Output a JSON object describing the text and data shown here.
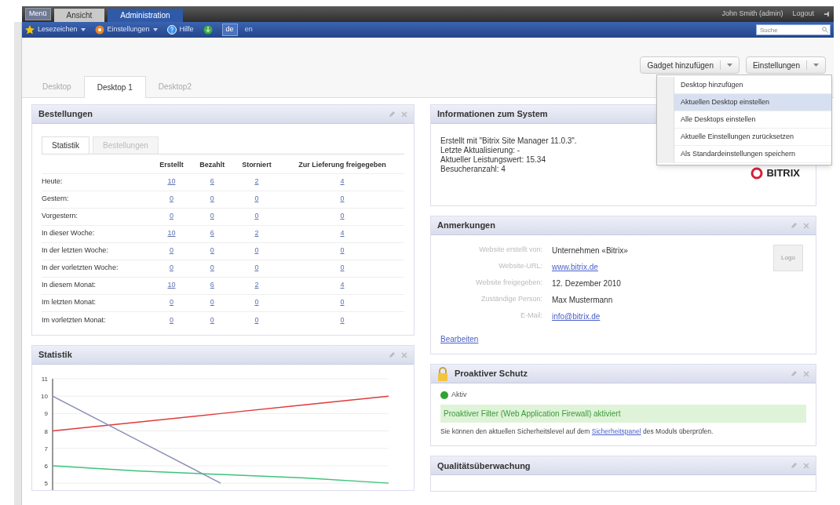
{
  "top_bar": {
    "menu_button": "Menü",
    "tabs": [
      {
        "label": "Ansicht",
        "selected": false
      },
      {
        "label": "Administration",
        "selected": true
      }
    ],
    "user": "John Smith (admin)",
    "logout": "Logout"
  },
  "toolbar": {
    "items": [
      {
        "label": "Lesezeichen",
        "kind": "star",
        "dropdown": true
      },
      {
        "label": "Einstellungen",
        "kind": "gear",
        "dropdown": true
      },
      {
        "label": "Hilfe",
        "kind": "help",
        "dropdown": false
      }
    ],
    "languages": [
      {
        "label": "de",
        "selected": true
      },
      {
        "label": "en",
        "selected": false
      }
    ],
    "search": {
      "placeholder": "Suche"
    }
  },
  "desktop_tabs": [
    {
      "label": "Desktop",
      "selected": false
    },
    {
      "label": "Desktop 1",
      "selected": true
    },
    {
      "label": "Desktop2",
      "selected": false
    }
  ],
  "actions": [
    "Gadget hinzufügen",
    "Einstellungen"
  ],
  "settings_menu": [
    {
      "label": "Desktop hinzufügen",
      "selected": false
    },
    {
      "label": "Aktuellen Desktop einstellen",
      "selected": true
    },
    {
      "label": "Alle Desktops einstellen",
      "selected": false
    },
    {
      "label": "Aktuelle Einstellungen zurücksetzen",
      "selected": false
    },
    {
      "label": "Als Standardeinstellungen speichern",
      "selected": false
    }
  ],
  "orders": {
    "title": "Bestellungen",
    "tabs": [
      {
        "label": "Statistik",
        "selected": true
      },
      {
        "label": "Bestellungen",
        "selected": false
      }
    ],
    "columns": [
      "Erstellt",
      "Bezahlt",
      "Storniert",
      "Zur Lieferung freigegeben"
    ],
    "rows": [
      {
        "label": "Heute:",
        "values": [
          "10",
          "6",
          "2",
          "4"
        ]
      },
      {
        "label": "Gestern:",
        "values": [
          "0",
          "0",
          "0",
          "0"
        ]
      },
      {
        "label": "Vorgestern:",
        "values": [
          "0",
          "0",
          "0",
          "0"
        ]
      },
      {
        "label": "In dieser Woche:",
        "values": [
          "10",
          "6",
          "2",
          "4"
        ]
      },
      {
        "label": "In der letzten Woche:",
        "values": [
          "0",
          "0",
          "0",
          "0"
        ]
      },
      {
        "label": "In der vorletzten Woche:",
        "values": [
          "0",
          "0",
          "0",
          "0"
        ]
      },
      {
        "label": "In diesem Monat:",
        "values": [
          "10",
          "6",
          "2",
          "4"
        ]
      },
      {
        "label": "Im letzten Monat:",
        "values": [
          "0",
          "0",
          "0",
          "0"
        ]
      },
      {
        "label": "Im vorletzten Monat:",
        "values": [
          "0",
          "0",
          "0",
          "0"
        ]
      }
    ]
  },
  "statistics": {
    "title": "Statistik",
    "chart_data": {
      "type": "line",
      "grid": true,
      "ylim": [
        4.6,
        11
      ],
      "yticks": [
        5,
        6,
        7,
        8,
        9,
        10,
        11
      ],
      "series": [
        {
          "color": "#e03a3a",
          "values": [
            8,
            8.5,
            9,
            9.5,
            10
          ]
        },
        {
          "color": "#8a8fb8",
          "values": [
            10,
            7.5,
            5,
            null,
            null
          ]
        },
        {
          "color": "#3cc47a",
          "values": [
            6,
            5.7,
            5.5,
            5.3,
            5
          ]
        }
      ]
    }
  },
  "system_info": {
    "title": "Informationen zum System",
    "lines": [
      "Erstellt mit \"Bitrix Site Manager 11.0.3\".",
      "Letzte Aktualisierung: -",
      "Aktueller Leistungswert: 15.34",
      "Besucheranzahl: 4"
    ],
    "logo": "BITRIX"
  },
  "notes": {
    "title": "Anmerkungen",
    "fields": [
      {
        "label": "Website erstellt von:",
        "value": "Unternehmen «Bitrix»",
        "kind": "text"
      },
      {
        "label": "Website-URL:",
        "value": "www.bitrix.de",
        "kind": "link"
      },
      {
        "label": "Website freigegeben:",
        "value": "12. Dezember 2010",
        "kind": "text"
      },
      {
        "label": "Zuständige Person:",
        "value": "Max Mustermann",
        "kind": "text"
      },
      {
        "label": "E-Mail:",
        "value": "info@bitrix.de",
        "kind": "link"
      }
    ],
    "logo_button": "Logo",
    "edit_link": "Bearbeiten"
  },
  "protection": {
    "title": "Proaktiver Schutz",
    "status": {
      "label": "Aktiv",
      "color": "#2fa52f"
    },
    "message": "Proaktiver Filter (Web Application Firewall) aktiviert",
    "note_before": "Sie können den aktuellen Sicherheitslevel auf dem",
    "note_link": "Sicherheitspanel",
    "note_after": "des Moduls überprüfen."
  },
  "quality": {
    "title": "Qualitätsüberwachung"
  }
}
